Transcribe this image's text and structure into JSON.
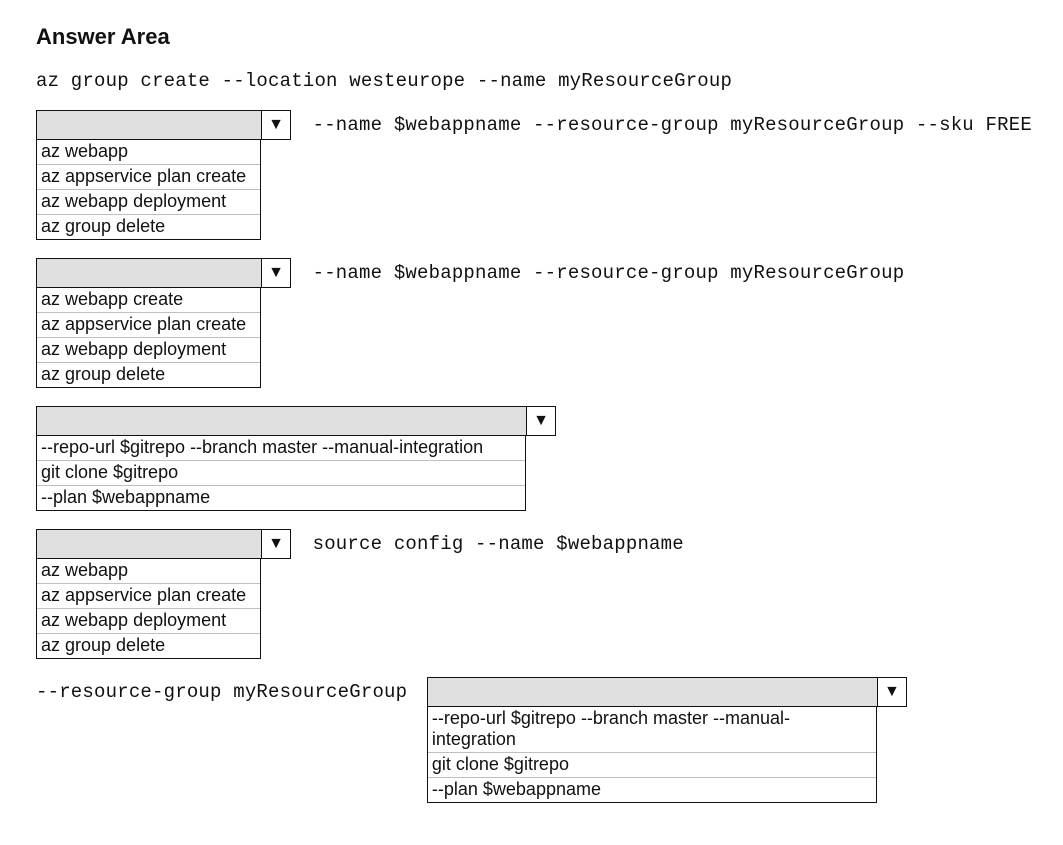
{
  "title": "Answer Area",
  "line1": "az group create --location westeurope --name myResourceGroup",
  "dropdown_a": {
    "trailing": " --name $webappname --resource-group myResourceGroup --sku FREE",
    "options": [
      "az webapp",
      "az appservice plan create",
      "az webapp deployment",
      "az group delete"
    ]
  },
  "dropdown_b": {
    "trailing": " --name $webappname --resource-group myResourceGroup",
    "options": [
      "az webapp create",
      "az appservice plan create",
      "az webapp deployment",
      "az group delete"
    ]
  },
  "dropdown_c": {
    "options": [
      "--repo-url $gitrepo --branch master --manual-integration",
      "git clone $gitrepo",
      "--plan $webappname"
    ]
  },
  "dropdown_d": {
    "trailing": " source config --name $webappname",
    "options": [
      "az webapp",
      "az appservice plan create",
      "az webapp deployment",
      "az group delete"
    ]
  },
  "dropdown_e": {
    "prefix": "--resource-group myResourceGroup ",
    "options": [
      "--repo-url $gitrepo --branch master --manual-integration",
      "git clone $gitrepo",
      "--plan $webappname"
    ]
  }
}
